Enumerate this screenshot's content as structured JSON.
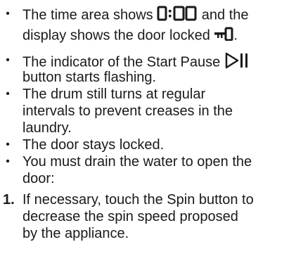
{
  "bullets": [
    {
      "lines": [
        "The time area shows",
        "and the",
        "display shows the door locked",
        "."
      ]
    },
    {
      "lines": [
        "The indicator of the Start Pause",
        "button starts flashing."
      ]
    },
    {
      "lines": [
        "The drum still turns at regular",
        "intervals to prevent creases in the",
        "laundry."
      ]
    },
    {
      "lines": [
        "The door stays locked."
      ]
    },
    {
      "lines": [
        "You must drain the water to open the",
        "door:"
      ]
    }
  ],
  "steps": [
    {
      "number": "1.",
      "lines": [
        "If necessary, touch the Spin button to",
        "decrease the spin speed proposed",
        "by the appliance."
      ]
    }
  ],
  "bullet_glyph": "•",
  "icons": {
    "display_time": "display-0-00-icon",
    "door_lock": "door-lock-icon",
    "start_pause": "start-pause-icon"
  }
}
